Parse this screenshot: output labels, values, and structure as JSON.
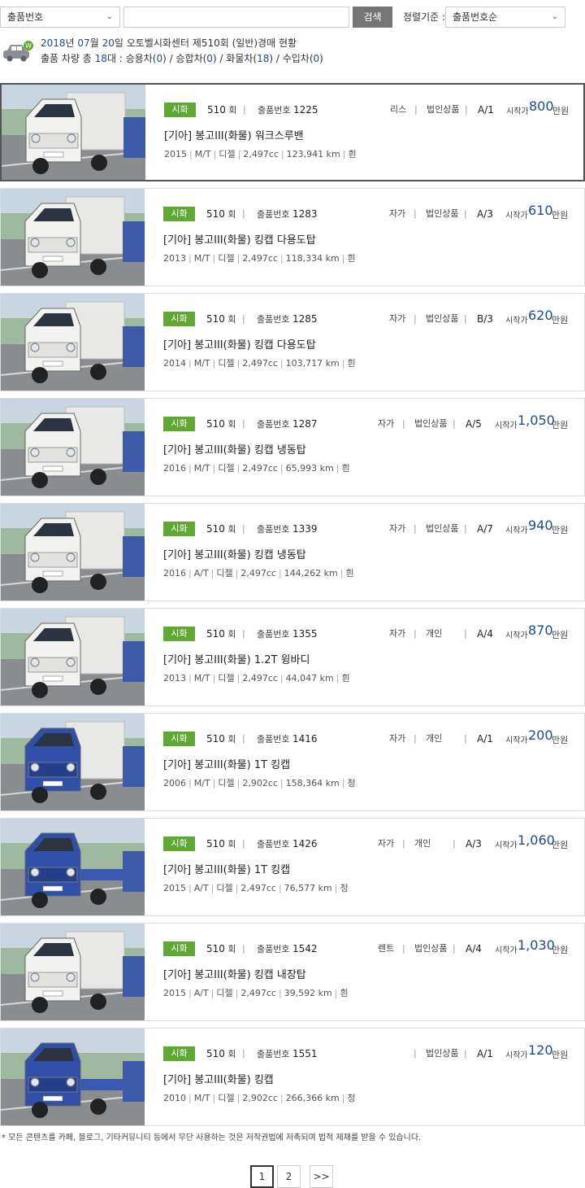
{
  "search": {
    "field_select": "출품번호",
    "input_value": "",
    "button": "검색",
    "sort_label": "정렬기준 :",
    "sort_select": "출품번호순"
  },
  "summary": {
    "year": "2018",
    "year_unit": "년",
    "month": "07",
    "month_unit": "월",
    "day": "20",
    "day_rest": "일 오토벨시화센터 제510회 (일반)경매 현황",
    "icon_letter": "W",
    "total_prefix": "출품 차량 총",
    "total_count": "18",
    "total_suffix": "대 :",
    "cat1": "승용차(",
    "cat1_count": "0",
    "cat2": ") / 승합차(",
    "cat2_count": "0",
    "cat3": ") / 화물차(",
    "cat3_count": "18",
    "cat4": ") / 수입차(",
    "cat4_count": "0",
    "cat_end": ")"
  },
  "labels": {
    "round_unit": "회",
    "lot_label": "출품번호",
    "start_label": "시작가",
    "won_unit": "만원"
  },
  "listings": [
    {
      "badge": "시화",
      "round": "510",
      "lot": "1225",
      "ownership": "리스",
      "ownership_type": "법인상품",
      "grade": "A/1",
      "price": "800",
      "title": "[기아] 봉고III(화물) 워크스루밴",
      "year": "2015",
      "trans": "M/T",
      "fuel": "디젤",
      "cc": "2,497cc",
      "km": "123,941 km",
      "color": "흰",
      "body": "white",
      "box": "white"
    },
    {
      "badge": "시화",
      "round": "510",
      "lot": "1283",
      "ownership": "자가",
      "ownership_type": "법인상품",
      "grade": "A/3",
      "price": "610",
      "title": "[기아] 봉고III(화물) 킹캡 다용도탑",
      "year": "2013",
      "trans": "M/T",
      "fuel": "디젤",
      "cc": "2,497cc",
      "km": "118,334 km",
      "color": "흰",
      "body": "white",
      "box": "white"
    },
    {
      "badge": "시화",
      "round": "510",
      "lot": "1285",
      "ownership": "자가",
      "ownership_type": "법인상품",
      "grade": "B/3",
      "price": "620",
      "title": "[기아] 봉고III(화물) 킹캡 다용도탑",
      "year": "2014",
      "trans": "M/T",
      "fuel": "디젤",
      "cc": "2,497cc",
      "km": "103,717 km",
      "color": "흰",
      "body": "white",
      "box": "white"
    },
    {
      "badge": "시화",
      "round": "510",
      "lot": "1287",
      "ownership": "자가",
      "ownership_type": "법인상품",
      "grade": "A/5",
      "price": "1,050",
      "title": "[기아] 봉고III(화물) 킹캡 냉동탑",
      "year": "2016",
      "trans": "M/T",
      "fuel": "디젤",
      "cc": "2,497cc",
      "km": "65,993 km",
      "color": "흰",
      "body": "white",
      "box": "white"
    },
    {
      "badge": "시화",
      "round": "510",
      "lot": "1339",
      "ownership": "자가",
      "ownership_type": "법인상품",
      "grade": "A/7",
      "price": "940",
      "title": "[기아] 봉고III(화물) 킹캡 냉동탑",
      "year": "2016",
      "trans": "A/T",
      "fuel": "디젤",
      "cc": "2,497cc",
      "km": "144,262 km",
      "color": "흰",
      "body": "white",
      "box": "white"
    },
    {
      "badge": "시화",
      "round": "510",
      "lot": "1355",
      "ownership": "자가",
      "ownership_type": "개인",
      "grade": "A/4",
      "price": "870",
      "title": "[기아] 봉고III(화물) 1.2T 윙바디",
      "year": "2013",
      "trans": "M/T",
      "fuel": "디젤",
      "cc": "2,497cc",
      "km": "44,047 km",
      "color": "흰",
      "body": "white",
      "box": "white"
    },
    {
      "badge": "시화",
      "round": "510",
      "lot": "1416",
      "ownership": "자가",
      "ownership_type": "개인",
      "grade": "A/1",
      "price": "200",
      "title": "[기아] 봉고III(화물) 1T 킹캡",
      "year": "2006",
      "trans": "M/T",
      "fuel": "디젤",
      "cc": "2,902cc",
      "km": "158,364 km",
      "color": "청",
      "body": "blue",
      "box": "white"
    },
    {
      "badge": "시화",
      "round": "510",
      "lot": "1426",
      "ownership": "자가",
      "ownership_type": "개인",
      "grade": "A/3",
      "price": "1,060",
      "title": "[기아] 봉고III(화물) 1T 킹캡",
      "year": "2015",
      "trans": "A/T",
      "fuel": "디젤",
      "cc": "2,497cc",
      "km": "76,577 km",
      "color": "청",
      "body": "blue",
      "box": "none"
    },
    {
      "badge": "시화",
      "round": "510",
      "lot": "1542",
      "ownership": "렌트",
      "ownership_type": "법인상품",
      "grade": "A/4",
      "price": "1,030",
      "title": "[기아] 봉고III(화물) 킹캡 내장탑",
      "year": "2015",
      "trans": "A/T",
      "fuel": "디젤",
      "cc": "2,497cc",
      "km": "39,592 km",
      "color": "흰",
      "body": "white",
      "box": "white"
    },
    {
      "badge": "시화",
      "round": "510",
      "lot": "1551",
      "ownership": "",
      "ownership_type": "법인상품",
      "grade": "A/1",
      "price": "120",
      "title": "[기아] 봉고III(화물) 킹캡",
      "year": "2010",
      "trans": "M/T",
      "fuel": "디젤",
      "cc": "2,902cc",
      "km": "266,366 km",
      "color": "청",
      "body": "blue",
      "box": "none"
    }
  ],
  "notice": "* 모든 콘텐츠를 카페, 블로그, 기타커뮤니티 등에서 무단 사용하는 것은 저작권법에 저촉되며 법적 제재를 받을 수 있습니다.",
  "pagination": {
    "pages": [
      "1",
      "2"
    ],
    "current": "1",
    "next": ">>"
  },
  "colors": {
    "accent_blue": "#1e4a8c",
    "badge_green": "#5fa833",
    "search_btn": "#757575"
  }
}
